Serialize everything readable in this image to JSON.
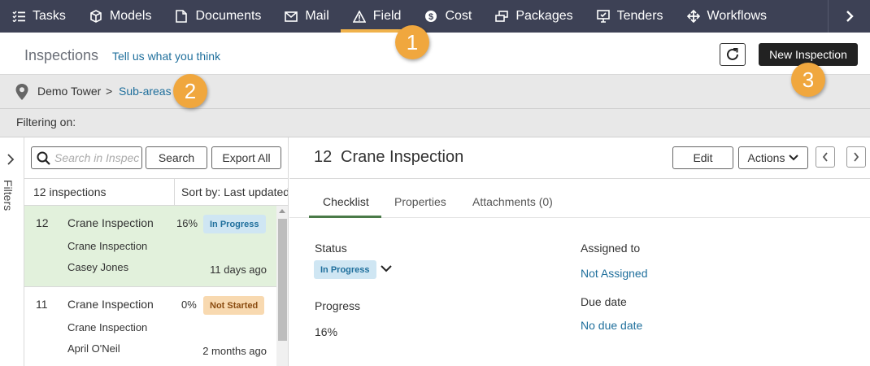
{
  "topnav": {
    "items": [
      {
        "label": "Tasks",
        "icon": "tasks-icon"
      },
      {
        "label": "Models",
        "icon": "cube-icon"
      },
      {
        "label": "Documents",
        "icon": "document-icon"
      },
      {
        "label": "Mail",
        "icon": "mail-icon"
      },
      {
        "label": "Field",
        "icon": "warning-triangle-icon",
        "active": true
      },
      {
        "label": "Cost",
        "icon": "dollar-icon"
      },
      {
        "label": "Packages",
        "icon": "packages-icon"
      },
      {
        "label": "Tenders",
        "icon": "tenders-icon"
      },
      {
        "label": "Workflows",
        "icon": "workflows-icon"
      }
    ]
  },
  "header": {
    "title": "Inspections",
    "feedback_link": "Tell us what you think",
    "new_button": "New Inspection"
  },
  "breadcrumb": {
    "root": "Demo Tower",
    "separator": ">",
    "current": "Sub-areas"
  },
  "filterbar": {
    "label": "Filtering on:"
  },
  "rail": {
    "label": "Filters"
  },
  "list": {
    "search_placeholder": "Search in Inspections",
    "search_button": "Search",
    "export_button": "Export All",
    "count": "12 inspections",
    "sort": "Sort by: Last updated",
    "rows": [
      {
        "number": "12",
        "title": "Crane Inspection",
        "subtitle": "Crane Inspection",
        "user": "Casey Jones",
        "progress": "16%",
        "status": "In Progress",
        "time": "11 days ago",
        "selected": true
      },
      {
        "number": "11",
        "title": "Crane Inspection",
        "subtitle": "Crane Inspection",
        "user": "April O'Neil",
        "progress": "0%",
        "status": "Not Started",
        "time": "2 months ago",
        "selected": false
      }
    ]
  },
  "detail": {
    "number": "12",
    "title": "Crane Inspection",
    "edit_button": "Edit",
    "actions_button": "Actions",
    "tabs": [
      "Checklist",
      "Properties",
      "Attachments (0)"
    ],
    "active_tab": "Checklist",
    "status_label": "Status",
    "status_value": "In Progress",
    "progress_label": "Progress",
    "progress_value": "16%",
    "assigned_label": "Assigned to",
    "assigned_value": "Not Assigned",
    "due_label": "Due date",
    "due_value": "No due date"
  },
  "callouts": [
    "1",
    "2",
    "3"
  ],
  "colors": {
    "nav_bg": "#3d4155",
    "nav_active": "#f0b24b",
    "link": "#1f6f9c",
    "selected_row": "#e2f1dc",
    "callout": "#f0a73e",
    "in_progress_bg": "#cfe6f3",
    "not_started_bg": "#f8d9b0"
  }
}
